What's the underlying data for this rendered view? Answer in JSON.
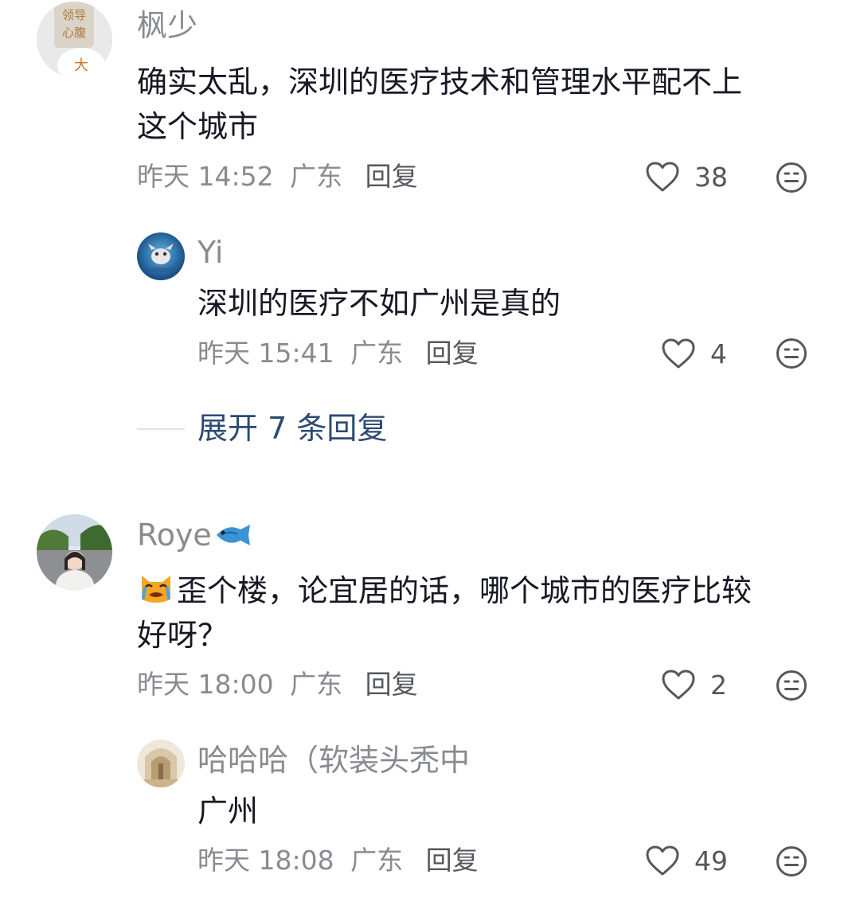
{
  "comments": [
    {
      "username": "枫少",
      "text_line1": "确实太乱，深圳的医疗技术和管理水平配不上",
      "text_line2": "这个城市",
      "time": "昨天 14:52",
      "location": "广东",
      "reply_label": "回复",
      "likes": "38",
      "avatar_text": [
        "领导",
        "心腹",
        "大"
      ],
      "replies": [
        {
          "username": "Yi",
          "text": "深圳的医疗不如广州是真的",
          "time": "昨天 15:41",
          "location": "广东",
          "reply_label": "回复",
          "likes": "4"
        }
      ],
      "expand_label": "展开 7 条回复"
    },
    {
      "username": "Roye",
      "username_emoji": "fish-emoji",
      "text_emoji": "crying-cat-emoji",
      "text_line1": "歪个楼，论宜居的话，哪个城市的医疗比较",
      "text_line2": "好呀？",
      "time": "昨天 18:00",
      "location": "广东",
      "reply_label": "回复",
      "likes": "2",
      "replies": [
        {
          "username": "哈哈哈（软装头秃中",
          "text": "广州",
          "time": "昨天 18:08",
          "location": "广东",
          "reply_label": "回复",
          "likes": "49"
        }
      ]
    }
  ],
  "icons": {
    "like": "heart-outline-icon",
    "react": "neutral-face-icon"
  },
  "colors": {
    "text": "#161823",
    "meta": "#8a8b91",
    "expand": "#2c4a73"
  }
}
